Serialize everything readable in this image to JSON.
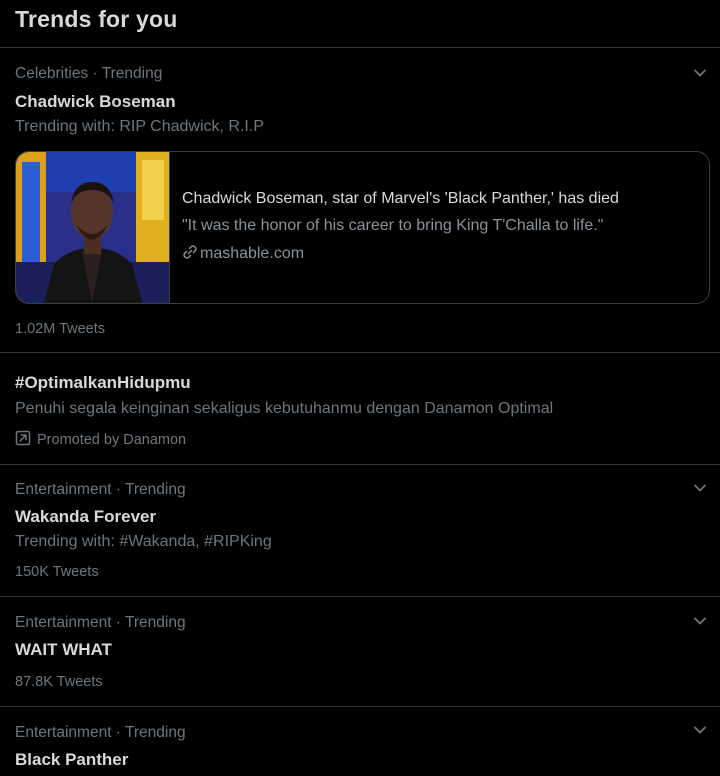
{
  "panel": {
    "title": "Trends for you"
  },
  "trends": [
    {
      "meta": "Celebrities · Trending",
      "name": "Chadwick Boseman",
      "trending_with": "Trending with: RIP Chadwick, R.I.P",
      "card": {
        "title": "Chadwick Boseman, star of Marvel's 'Black Panther,' has died",
        "description": "\"It was the honor of his career to bring King T'Challa to life.\"",
        "domain": "mashable.com",
        "image_icon": "photo-thumbnail"
      },
      "count": "1.02M Tweets",
      "menu_icon": "chevron-down-icon"
    },
    {
      "name": "#OptimalkanHidupmu",
      "description": "Penuhi segala keinginan sekaligus kebutuhanmu dengan Danamon Optimal",
      "promoted": "Promoted by Danamon",
      "promoted_icon": "promoted-icon"
    },
    {
      "meta": "Entertainment · Trending",
      "name": "Wakanda Forever",
      "trending_with": "Trending with: #Wakanda, #RIPKing",
      "count": "150K Tweets",
      "menu_icon": "chevron-down-icon"
    },
    {
      "meta": "Entertainment · Trending",
      "name": "WAIT WHAT",
      "count": "87.8K Tweets",
      "menu_icon": "chevron-down-icon"
    },
    {
      "meta": "Entertainment · Trending",
      "name": "Black Panther",
      "menu_icon": "chevron-down-icon"
    }
  ],
  "colors": {
    "background": "#000000",
    "primary_text": "#d9d9d9",
    "secondary_text": "#6e767d",
    "divider": "#2f3336"
  }
}
